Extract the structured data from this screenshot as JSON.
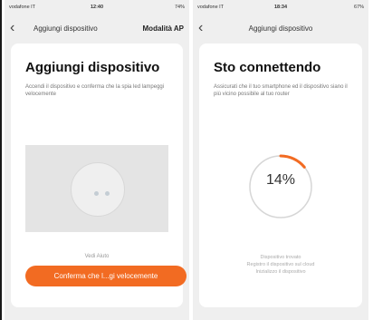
{
  "left_screen": {
    "status": {
      "carrier": "vodafone IT",
      "time": "12:40",
      "battery": "74%"
    },
    "nav": {
      "title": "Aggiungi dispositivo",
      "action": "Modalità AP"
    },
    "card": {
      "title": "Aggiungi dispositivo",
      "text": "Accendi il dispositivo e conferma che la spia led lampeggi velocemente",
      "help_link": "Vedi Aiuto",
      "confirm_button": "Conferma che l...gi velocemente"
    }
  },
  "right_screen": {
    "status": {
      "carrier": "vodafone IT",
      "time": "18:34",
      "battery": "67%"
    },
    "nav": {
      "title": "Aggiungi dispositivo"
    },
    "card": {
      "title": "Sto connettendo",
      "text": "Assicurati che il tuo smartphone ed il dispositivo siano il più vicino possibile al tuo router",
      "progress_label": "14%",
      "progress_value": 0.14,
      "steps": [
        "Dispositivo trovato",
        "Registro il dispositivo sul cloud",
        "Inizializzo il dispositivo"
      ]
    }
  },
  "colors": {
    "accent": "#f26b22",
    "card": "#ffffff",
    "background": "#efefef"
  }
}
